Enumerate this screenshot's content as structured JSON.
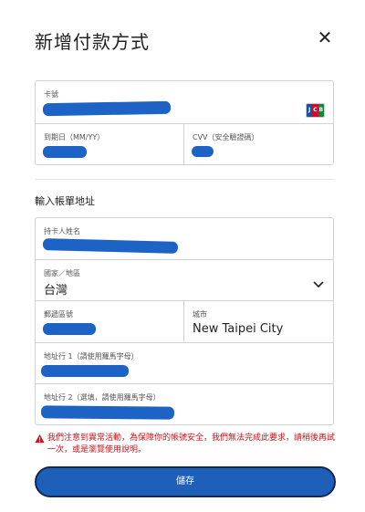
{
  "dialog": {
    "title": "新增付款方式",
    "close_label": "✕"
  },
  "card": {
    "number_label": "卡號",
    "brand_icon": "jcb-card-icon",
    "expiry_label": "到期日（MM/YY）",
    "cvv_label": "CVV（安全驗證碼）"
  },
  "billing": {
    "section_title": "輸入帳單地址",
    "cardholder_label": "持卡人姓名",
    "country_label": "國家／地區",
    "country_value": "台灣",
    "postal_label": "郵遞區號",
    "city_label": "城市",
    "city_value": "New Taipei City",
    "address1_label": "地址行 1（請使用羅馬字母）",
    "address2_label": "地址行 2（選填，請使用羅馬字母）"
  },
  "warning": {
    "text": "我們注意到異常活動，為保障你的帳號安全，我們無法完成此要求，請稍後再試一次，或是瀏覽使用說明。",
    "color": "#c4141b"
  },
  "actions": {
    "save_label": "儲存"
  },
  "colors": {
    "accent": "#1d5fb9",
    "redaction": "#1d63c6"
  }
}
